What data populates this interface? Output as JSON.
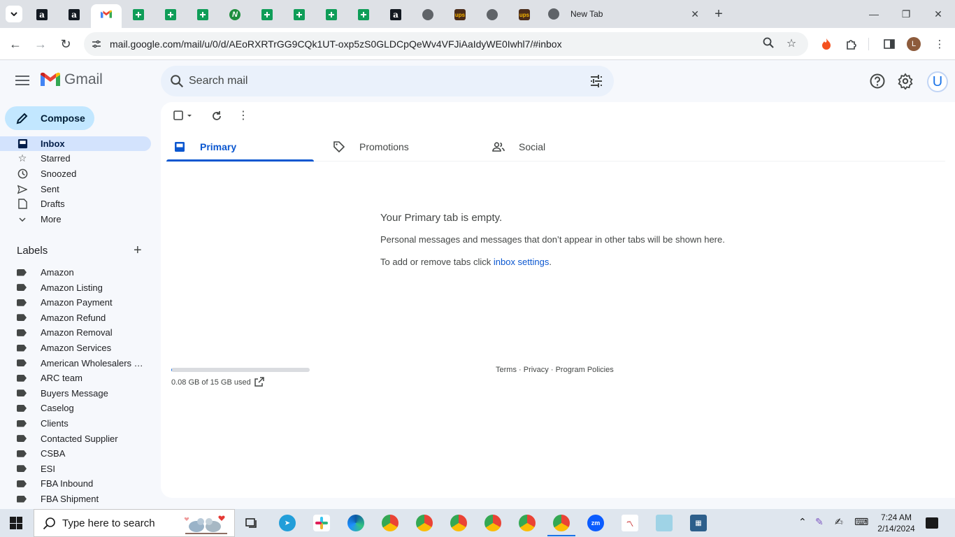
{
  "browser": {
    "active_tab_title": "New Tab",
    "url": "mail.google.com/mail/u/0/d/AEoRXRTrGG9CQk1UT-oxp5zS0GLDCpQeWv4VFJiAaIdyWE0Iwhl7/#inbox",
    "profile_initial": "L",
    "pinned_tabs": [
      "amazon",
      "amazon",
      "gmail",
      "sheets",
      "sheets",
      "sheets",
      "green",
      "sheets",
      "sheets",
      "sheets",
      "sheets",
      "amazon",
      "globe",
      "ups",
      "globe",
      "ups"
    ]
  },
  "gmail": {
    "app_name": "Gmail",
    "search_placeholder": "Search mail",
    "avatar_initial": "U",
    "compose_label": "Compose",
    "nav": [
      {
        "label": "Inbox",
        "icon": "inbox-icon",
        "active": true
      },
      {
        "label": "Starred",
        "icon": "star-icon"
      },
      {
        "label": "Snoozed",
        "icon": "clock-icon"
      },
      {
        "label": "Sent",
        "icon": "send-icon"
      },
      {
        "label": "Drafts",
        "icon": "draft-icon"
      },
      {
        "label": "More",
        "icon": "chevron-down-icon"
      }
    ],
    "labels_heading": "Labels",
    "labels": [
      "Amazon",
      "Amazon Listing",
      "Amazon Payment",
      "Amazon Refund",
      "Amazon Removal",
      "Amazon Services",
      "American Wholesalers L...",
      "ARC team",
      "Buyers Message",
      "Caselog",
      "Clients",
      "Contacted Supplier",
      "CSBA",
      "ESI",
      "FBA Inbound",
      "FBA Shipment"
    ],
    "tabs": [
      {
        "label": "Primary",
        "active": true
      },
      {
        "label": "Promotions"
      },
      {
        "label": "Social"
      }
    ],
    "empty": {
      "title": "Your Primary tab is empty.",
      "description": "Personal messages and messages that don’t appear in other tabs will be shown here.",
      "settings_prefix": "To add or remove tabs click ",
      "settings_link": "inbox settings",
      "settings_suffix": "."
    },
    "storage": {
      "text": "0.08 GB of 15 GB used",
      "used_fraction": 0.005
    },
    "footer": {
      "terms": "Terms",
      "privacy": "Privacy",
      "policies": "Program Policies",
      "sep": " · "
    }
  },
  "taskbar": {
    "search_placeholder": "Type here to search",
    "time": "7:24 AM",
    "date": "2/14/2024"
  },
  "colors": {
    "accent": "#0b57d0",
    "compose_bg": "#c2e7ff",
    "active_nav_bg": "#d3e3fd"
  }
}
